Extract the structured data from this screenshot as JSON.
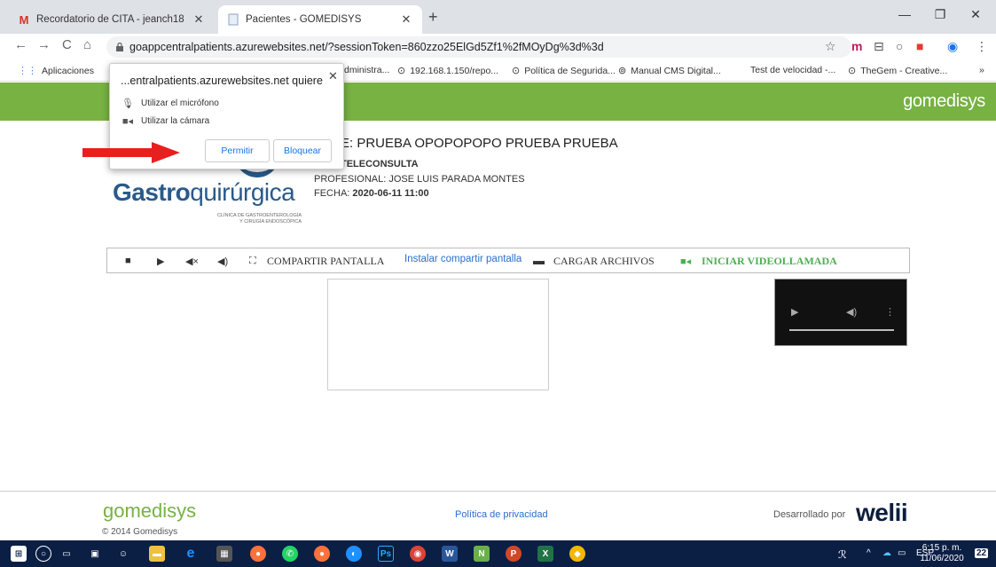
{
  "browser": {
    "tabs": [
      {
        "title": "Recordatorio de CITA - jeanch18",
        "favicon": "gmail-icon",
        "active": false
      },
      {
        "title": "Pacientes - GOMEDISYS",
        "favicon": "page-icon",
        "active": true
      }
    ],
    "new_tab": "+",
    "url": "goappcentralpatients.azurewebsites.net/?sessionToken=860zzo25ElGd5Zf1%2fMOyDg%3d%3d",
    "bookmarks": [
      {
        "label": "Aplicaciones",
        "icon": "apps-grid-icon"
      },
      {
        "label": "dministra...",
        "icon": "page-icon"
      },
      {
        "label": "192.168.1.150/repo...",
        "icon": "globe-icon"
      },
      {
        "label": "Política de Segurida...",
        "icon": "globe-icon"
      },
      {
        "label": "Manual CMS Digital...",
        "icon": "eye-icon"
      },
      {
        "label": "Test de velocidad -...",
        "icon": "none"
      },
      {
        "label": "TheGem - Creative...",
        "icon": "globe-icon"
      }
    ],
    "bookmarks_more": "»"
  },
  "popup": {
    "title": "...entralpatients.azurewebsites.net quiere",
    "permissions": [
      {
        "label": "Utilizar el micrófono",
        "icon": "microphone-icon"
      },
      {
        "label": "Utilizar la cámara",
        "icon": "camera-icon"
      }
    ],
    "allow": "Permitir",
    "block": "Bloquear"
  },
  "header": {
    "brand": "gomedisys",
    "brand_color": "#77b243"
  },
  "clinic": {
    "name_bold": "Gastro",
    "name_light": "quirúrgica",
    "subtitle_1": "CLÍNICA DE GASTROENTEROLOGÍA",
    "subtitle_2": "Y CIRUGÍA ENDOSCÓPICA"
  },
  "patient": {
    "title": "ENTE: PRUEBA OPOPOPOPO PRUEBA PRUEBA",
    "origin_label": "EN: TELECONSULTA",
    "professional": "PROFESIONAL: JOSE LUIS PARADA MONTES",
    "date_label": "FECHA:",
    "date_value": "2020-06-11 11:00"
  },
  "toolbar": {
    "share_screen": "COMPARTIR  PANTALLA",
    "install_share": "Instalar compartir pantalla",
    "upload_files": "CARGAR  ARCHIVOS",
    "start_call": "INICIAR  VIDEOLLAMADA"
  },
  "footer": {
    "brand": "gomedisys",
    "copyright": "© 2014 Gomedisys",
    "privacy": "Política de privacidad",
    "developed_by": "Desarrollado por",
    "developer": "welii"
  },
  "taskbar": {
    "lang": "ESP",
    "time": "6:15 p. m.",
    "date": "11/06/2020",
    "notifications": "22"
  }
}
